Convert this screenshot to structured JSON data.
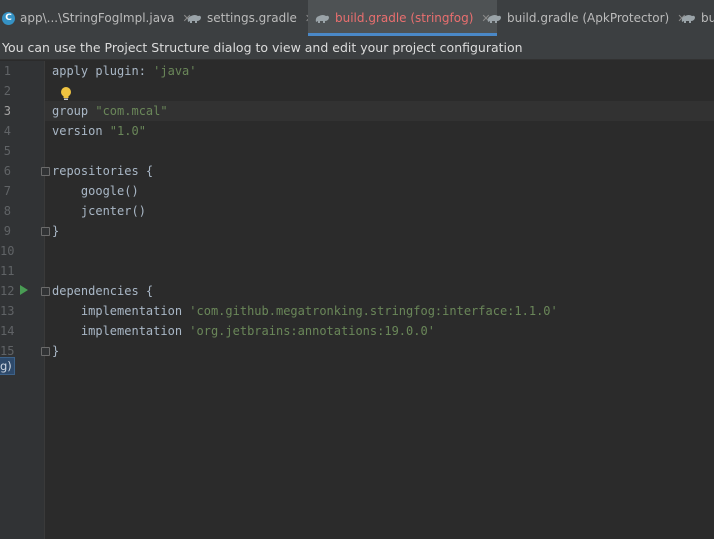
{
  "tabs": [
    {
      "label": "app\\...\\StringFogImpl.java",
      "icon": "java-class-icon",
      "icon_glyph": "C",
      "active": false
    },
    {
      "label": "settings.gradle",
      "icon": "gradle-icon",
      "active": false
    },
    {
      "label": "build.gradle (stringfog)",
      "icon": "gradle-icon",
      "active": true
    },
    {
      "label": "build.gradle (ApkProtector)",
      "icon": "gradle-icon",
      "active": false
    },
    {
      "label": "bu",
      "icon": "gradle-icon",
      "active": false
    }
  ],
  "tab_close_glyph": "✕",
  "notification": "You can use the Project Structure dialog to view and edit your project configuration",
  "lines": [
    {
      "num": "1",
      "tokens": [
        [
          "plain",
          "apply "
        ],
        [
          "plain",
          "plugin: "
        ],
        [
          "str",
          "'java'"
        ]
      ]
    },
    {
      "num": "2",
      "tokens": []
    },
    {
      "num": "3",
      "tokens": [
        [
          "plain",
          "group "
        ],
        [
          "str",
          "\"com.mcal\""
        ]
      ]
    },
    {
      "num": "4",
      "tokens": [
        [
          "plain",
          "version "
        ],
        [
          "str",
          "\"1.0\""
        ]
      ]
    },
    {
      "num": "5",
      "tokens": []
    },
    {
      "num": "6",
      "tokens": [
        [
          "plain",
          "repositories {"
        ]
      ]
    },
    {
      "num": "7",
      "tokens": [
        [
          "plain",
          "    google()"
        ]
      ]
    },
    {
      "num": "8",
      "tokens": [
        [
          "plain",
          "    jcenter()"
        ]
      ]
    },
    {
      "num": "9",
      "tokens": [
        [
          "plain",
          "}"
        ]
      ]
    },
    {
      "num": "10",
      "tokens": []
    },
    {
      "num": "11",
      "tokens": []
    },
    {
      "num": "12",
      "tokens": [
        [
          "plain",
          "dependencies {"
        ]
      ]
    },
    {
      "num": "13",
      "tokens": [
        [
          "plain",
          "    implementation "
        ],
        [
          "str",
          "'com.github.megatronking.stringfog:interface:1.1.0'"
        ]
      ]
    },
    {
      "num": "14",
      "tokens": [
        [
          "plain",
          "    implementation "
        ],
        [
          "str",
          "'org.jetbrains:annotations:19.0.0'"
        ]
      ]
    },
    {
      "num": "15",
      "tokens": [
        [
          "plain",
          "}"
        ]
      ]
    }
  ],
  "current_line": "3",
  "tooltip": "g)",
  "colors": {
    "background": "#2b2b2b",
    "gutter": "#313335",
    "string": "#6a8759",
    "plain": "#a9b7c6",
    "active_tab_text": "#e96f6f",
    "active_tab_underline": "#4a88c7"
  }
}
